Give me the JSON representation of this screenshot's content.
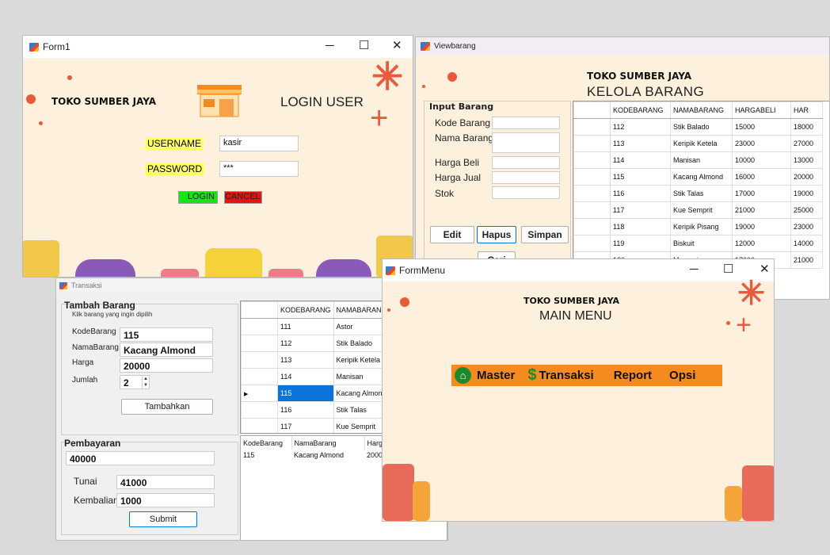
{
  "login": {
    "title": "Form1",
    "shop_name": "TOKO SUMBER JAYA",
    "heading": "LOGIN USER",
    "username_label": "USERNAME",
    "username_value": "kasir",
    "password_label": "PASSWORD",
    "password_value": "***",
    "login_button": "LOGIN",
    "cancel_button": "CANCEL"
  },
  "viewbarang": {
    "title": "Viewbarang",
    "shop_name": "TOKO SUMBER JAYA",
    "heading": "KELOLA BARANG",
    "input_group": "Input Barang",
    "labels": [
      "Kode Barang",
      "Nama Barang",
      "Harga Beli",
      "Harga Jual",
      "Stok"
    ],
    "edit_button": "Edit",
    "hapus_button": "Hapus",
    "simpan_button": "Simpan",
    "cari_button": "Cari",
    "columns": [
      "KODEBARANG",
      "NAMABARANG",
      "HARGABELI",
      "HAR"
    ],
    "rows": [
      [
        "112",
        "Stik Balado",
        "15000",
        "18000"
      ],
      [
        "113",
        "Keripik Ketela",
        "23000",
        "27000"
      ],
      [
        "114",
        "Manisan",
        "10000",
        "13000"
      ],
      [
        "115",
        "Kacang Almond",
        "16000",
        "20000"
      ],
      [
        "116",
        "Stik Talas",
        "17000",
        "19000"
      ],
      [
        "117",
        "Kue Semprit",
        "21000",
        "25000"
      ],
      [
        "118",
        "Keripik Pisang",
        "19000",
        "23000"
      ],
      [
        "119",
        "Biskuit",
        "12000",
        "14000"
      ],
      [
        "120",
        "Momogi",
        "17000",
        "21000"
      ]
    ]
  },
  "transaksi": {
    "title": "Transaksi",
    "group_title": "Tambah Barang",
    "hint": "Klik barang yang ingin dipilih",
    "kode_label": "KodeBarang",
    "kode_value": "115",
    "nama_label": "NamaBarang",
    "nama_value": "Kacang Almond",
    "harga_label": "Harga",
    "harga_value": "20000",
    "jumlah_label": "Jumlah",
    "jumlah_value": "2",
    "tambahkan_button": "Tambahkan",
    "pembayaran_title": "Pembayaran",
    "total_value": "40000",
    "tunai_label": "Tunai",
    "tunai_value": "41000",
    "kembalian_label": "Kembalian",
    "kembalian_value": "1000",
    "submit_button": "Submit",
    "columns": [
      "KODEBARANG",
      "NAMABARANG",
      "H"
    ],
    "rows": [
      [
        "111",
        "Astor",
        "14"
      ],
      [
        "112",
        "Stik Balado",
        "15"
      ],
      [
        "113",
        "Keripik Ketela",
        "23"
      ],
      [
        "114",
        "Manisan",
        "10"
      ],
      [
        "115",
        "Kacang Almond",
        "16"
      ],
      [
        "116",
        "Stik Talas",
        "17"
      ],
      [
        "117",
        "Kue Semprit",
        "21"
      ]
    ],
    "cart_columns": [
      "KodeBarang",
      "NamaBarang",
      "Harga"
    ],
    "cart_rows": [
      [
        "115",
        "Kacang Almond",
        "2000"
      ]
    ]
  },
  "formmenu": {
    "title": "FormMenu",
    "shop_name": "TOKO SUMBER JAYA",
    "heading": "MAIN MENU",
    "menu": [
      "Master",
      "Transaksi",
      "Report",
      "Opsi"
    ]
  },
  "colors": {
    "form_bg": "#fdf0dc",
    "accent_orange": "#f58a1f",
    "login_green": "#16e416",
    "cancel_red": "#e41414",
    "highlight_yellow": "#ffff66",
    "selection_blue": "#0a74d8"
  },
  "icons": [
    "app-icon",
    "minimize-icon",
    "maximize-icon",
    "close-icon",
    "home-icon",
    "dollar-icon",
    "shop-icon",
    "row-pointer-icon",
    "spinner-arrows-icon"
  ]
}
